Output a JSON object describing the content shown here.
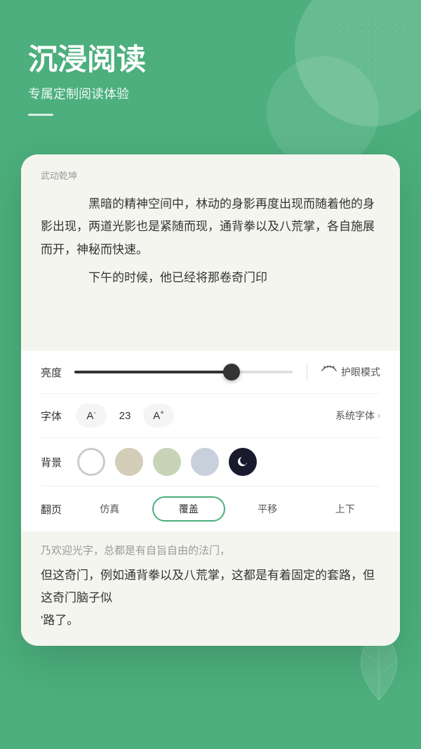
{
  "header": {
    "title": "沉浸阅读",
    "subtitle": "专属定制阅读体验"
  },
  "reading": {
    "book_title": "武动乾坤",
    "paragraphs": [
      "黑暗的精神空间中，林动的身影再度出现而随着他的身影出现，两道光影也是紧随而现，通背拳以及八荒掌，各自施展而开，神秘而快速。",
      "下午的时候，他已经将那卷奇门印"
    ]
  },
  "controls": {
    "brightness_label": "亮度",
    "brightness_value": 72,
    "eye_mode_label": "护眼模式",
    "font_label": "字体",
    "font_decrease": "A⁻",
    "font_size": "23",
    "font_increase": "A⁺",
    "font_family": "系统字体",
    "font_family_arrow": "›",
    "bg_label": "背景",
    "page_label": "翻页",
    "page_options": [
      "仿真",
      "覆盖",
      "平移",
      "上下"
    ],
    "page_active": "覆盖"
  },
  "bottom_reading": {
    "partial_top": "乃欢迎光字，总都是有自旨自由的法门，",
    "paragraphs": [
      "但这奇门，例如通背拳以及八荒掌，这都是有着固定的套路，但这奇门脑子似",
      "'路了。"
    ]
  },
  "colors": {
    "green": "#4caf7d",
    "bg_white": "#ffffff",
    "bg_cream": "#f5f5f0",
    "bg_tan": "#d4cdb8",
    "bg_sage": "#c8d4b8",
    "bg_lavender": "#c8d0dc",
    "bg_night": "#1a1a2e"
  }
}
